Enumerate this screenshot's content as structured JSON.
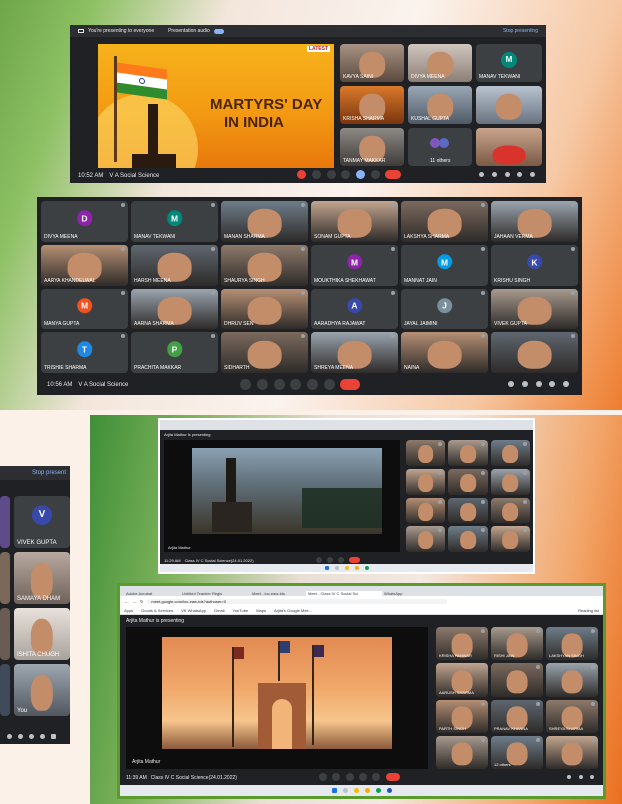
{
  "colors": {
    "meet_bg": "#202124",
    "tile": "#3c4043",
    "end_call": "#ea4335",
    "saffron": "#ee7d2e",
    "green": "#3f8f38"
  },
  "screen1": {
    "presenting_banner": "You're presenting to everyone",
    "presentation_audio": "Presentation audio",
    "stop_presenting": "Stop presenting",
    "slide_badge": "LATEST",
    "slide_title_line1": "MARTYRS' DAY",
    "slide_title_line2": "IN INDIA",
    "time": "10:52 AM",
    "meeting": "V A Social Science",
    "tiles": [
      {
        "name": "KAVYA SAINI",
        "avatar": ""
      },
      {
        "name": "DIVYA MEENA",
        "avatar": ""
      },
      {
        "name": "MANAV TEKWANI",
        "avatar": "M"
      },
      {
        "name": "KRISHA SHARMA",
        "avatar": ""
      },
      {
        "name": "KUSHAL GUPTA",
        "avatar": ""
      },
      {
        "name": "",
        "avatar": ""
      },
      {
        "name": "TANMAY MAKKAR",
        "avatar": ""
      },
      {
        "name": "11 others",
        "avatar": ""
      },
      {
        "name": "",
        "avatar": ""
      }
    ]
  },
  "screen2": {
    "time": "10:56 AM",
    "meeting": "V A Social Science",
    "tiles": [
      {
        "name": "DIVYA MEENA",
        "avatar": "D",
        "color": "#8e24aa"
      },
      {
        "name": "MANAV TEKWANI",
        "avatar": "M",
        "color": "#00897b"
      },
      {
        "name": "MANAN SHARMA",
        "avatar": "",
        "color": ""
      },
      {
        "name": "SONAM GUPTA",
        "avatar": "",
        "color": ""
      },
      {
        "name": "LAKSHYA SHARMA",
        "avatar": "",
        "color": ""
      },
      {
        "name": "JAHAAN VERMA",
        "avatar": "",
        "color": ""
      },
      {
        "name": "AARYA KHANDELWAL",
        "avatar": "",
        "color": ""
      },
      {
        "name": "HARSH MEENA",
        "avatar": "",
        "color": ""
      },
      {
        "name": "SHAURYA SINGH",
        "avatar": "",
        "color": ""
      },
      {
        "name": "MOUKTHIKA SHEKHAWAT",
        "avatar": "M",
        "color": "#8e24aa"
      },
      {
        "name": "MANNAT JAIN",
        "avatar": "M",
        "color": "#039be5"
      },
      {
        "name": "KRISHU SINGH",
        "avatar": "K",
        "color": "#3949ab"
      },
      {
        "name": "MANYA GUPTA",
        "avatar": "M",
        "color": "#f4511e"
      },
      {
        "name": "AARNA SHARMA",
        "avatar": "",
        "color": ""
      },
      {
        "name": "DHRUV SEN",
        "avatar": "",
        "color": ""
      },
      {
        "name": "AARADHYA RAJAWAT",
        "avatar": "A",
        "color": "#3949ab"
      },
      {
        "name": "JAYAL JAIMINI",
        "avatar": "J",
        "color": "#78909c"
      },
      {
        "name": "VIVEK GUPTA",
        "avatar": "",
        "color": ""
      },
      {
        "name": "TRISHIE SHARMA",
        "avatar": "T",
        "color": "#1e88e5"
      },
      {
        "name": "PRACHITA MAKKAR",
        "avatar": "P",
        "color": "#43a047"
      },
      {
        "name": "SIDHARTH",
        "avatar": "",
        "color": ""
      },
      {
        "name": "SHREYA MEENA",
        "avatar": "",
        "color": ""
      },
      {
        "name": "NAINA",
        "avatar": "",
        "color": ""
      },
      {
        "name": "",
        "avatar": "",
        "color": ""
      }
    ]
  },
  "screen3": {
    "stop_presenting": "Stop present",
    "tiles": [
      {
        "name": "",
        "avatar": ""
      },
      {
        "name": "VIVEK GUPTA",
        "avatar": "V"
      },
      {
        "name": "",
        "avatar": ""
      },
      {
        "name": "SAMAYA DHAM",
        "avatar": ""
      },
      {
        "name": "",
        "avatar": ""
      },
      {
        "name": "ISHITA CHUGH",
        "avatar": ""
      },
      {
        "name": "",
        "avatar": ""
      },
      {
        "name": "You",
        "avatar": ""
      }
    ]
  },
  "screen4": {
    "presenting_banner": "Arjita Mathur is presenting",
    "presenter_label": "Arjita Mathur",
    "time": "11:29 AM",
    "meeting": "Class IV C Social Science(24.01.2022)"
  },
  "screen5": {
    "tab1": "Adobe Acrobat",
    "tab2": "Untitled Teacher Regis",
    "tab3": "Meet - loc-eaw-tds",
    "tab4": "Meet - Class IV C Social Sci",
    "tab5": "WhatsApp",
    "url": "meet.google.com/loc-eaw-tds?authuser=0",
    "bookmarks": [
      "Apps",
      "Goods & Services",
      "VK WhatsApp",
      "Gmail",
      "YouTube",
      "Maps",
      "Arjita's Google Mee..."
    ],
    "reading_list": "Reading list",
    "presenting_banner": "Arjita Mathur is presenting",
    "presenter_label": "Arjita Mathur",
    "time": "11:39 AM",
    "meeting": "Class IV C Social Science(24.01.2022)",
    "tiles": [
      {
        "name": "KRISHA PANWAR",
        "avatar": ""
      },
      {
        "name": "RISHI JAIN",
        "avatar": ""
      },
      {
        "name": "LAKSHYAN SINGH",
        "avatar": ""
      },
      {
        "name": "AARUSH SHARMA",
        "avatar": ""
      },
      {
        "name": "",
        "avatar": ""
      },
      {
        "name": "",
        "avatar": ""
      },
      {
        "name": "PARTH SINGH",
        "avatar": ""
      },
      {
        "name": "PRANAV KHANNA",
        "avatar": ""
      },
      {
        "name": "SHREYA SHARMA",
        "avatar": ""
      },
      {
        "name": "",
        "avatar": ""
      },
      {
        "name": "12 others",
        "avatar": ""
      },
      {
        "name": "",
        "avatar": ""
      }
    ]
  }
}
